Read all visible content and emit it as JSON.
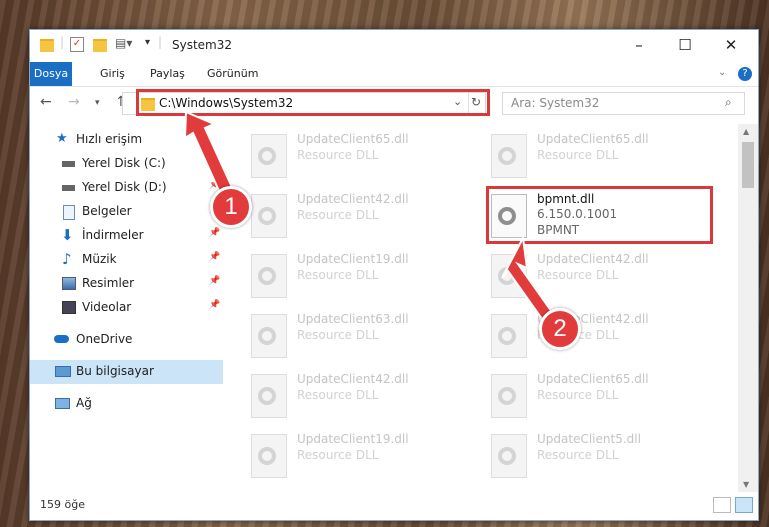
{
  "window": {
    "title": "System32"
  },
  "ribbon": {
    "tabs": [
      "Dosya",
      "Giriş",
      "Paylaş",
      "Görünüm"
    ]
  },
  "nav": {
    "address": "C:\\Windows\\System32",
    "search_placeholder": "Ara: System32"
  },
  "sidebar": {
    "items": [
      {
        "label": "Hızlı erişim",
        "icon": "star-icon"
      },
      {
        "label": "Yerel Disk (C:)",
        "icon": "drive-icon",
        "pinned": true
      },
      {
        "label": "Yerel Disk (D:)",
        "icon": "drive-icon",
        "pinned": true
      },
      {
        "label": "Belgeler",
        "icon": "document-icon",
        "pinned": true
      },
      {
        "label": "İndirmeler",
        "icon": "download-icon",
        "pinned": true
      },
      {
        "label": "Müzik",
        "icon": "music-icon",
        "pinned": true
      },
      {
        "label": "Resimler",
        "icon": "picture-icon",
        "pinned": true
      },
      {
        "label": "Videolar",
        "icon": "video-icon",
        "pinned": true
      },
      {
        "label": "OneDrive",
        "icon": "cloud-icon"
      },
      {
        "label": "Bu bilgisayar",
        "icon": "computer-icon",
        "selected": true
      },
      {
        "label": "Ağ",
        "icon": "network-icon"
      }
    ]
  },
  "files": [
    {
      "name": "UpdateClient65.dll",
      "type": "Resource DLL"
    },
    {
      "name": "UpdateClient65.dll",
      "type": "Resource DLL"
    },
    {
      "name": "UpdateClient42.dll",
      "type": "Resource DLL"
    },
    {
      "name": "bpmnt.dll",
      "version": "6.150.0.1001",
      "type": "BPMNT",
      "highlighted": true
    },
    {
      "name": "UpdateClient19.dll",
      "type": "Resource DLL"
    },
    {
      "name": "UpdateClient42.dll",
      "type": "Resource DLL"
    },
    {
      "name": "UpdateClient63.dll",
      "type": "Resource DLL"
    },
    {
      "name": "UpdateClient42.dll",
      "type": "Resource DLL"
    },
    {
      "name": "UpdateClient42.dll",
      "type": "Resource DLL"
    },
    {
      "name": "UpdateClient65.dll",
      "type": "Resource DLL"
    },
    {
      "name": "UpdateClient19.dll",
      "type": "Resource DLL"
    },
    {
      "name": "UpdateClient5.dll",
      "type": "Resource DLL"
    }
  ],
  "status": {
    "item_count": "159 öğe"
  },
  "callouts": [
    "1",
    "2"
  ],
  "colors": {
    "accent": "#1a6fc5",
    "highlight": "#d9393a",
    "selection": "#cce4f7"
  }
}
